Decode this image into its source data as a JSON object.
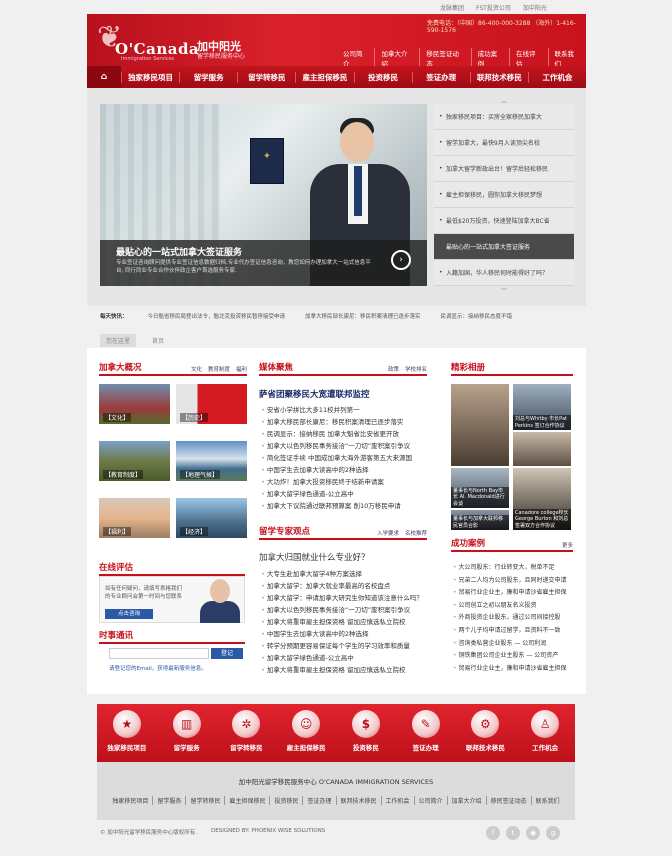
{
  "toplinks": [
    "龙脉集团",
    "FST投资公司",
    "加中阳光"
  ],
  "header": {
    "logo_name": "O'Canada",
    "logo_sub": "Immigration Services",
    "brand_cn": "加中阳光",
    "brand_cn_sub": "留学移民服务中心",
    "phone": "免费电话：（中国）86-400-000-3288 （海外）1-416-590-1576",
    "menu": [
      "公司简介",
      "加拿大介绍",
      "移民签证动态",
      "成功案例",
      "在线评估",
      "联系我们"
    ]
  },
  "nav": {
    "home_icon": "home-icon",
    "items": [
      "独家移民项目",
      "留学服务",
      "留学转移民",
      "雇主担保移民",
      "投资移民",
      "签证办理",
      "联邦技术移民",
      "工作机会"
    ]
  },
  "banner": {
    "headline": "最贴心的一站式加拿大签证服务",
    "desc": "专业签证咨询顾问提供专业签证信息数据归档,专业代办签证信息咨询，教您如何办理加拿大一站式信息平台, 同行同业专业合作伙伴政企客户首选服务专家.",
    "list": [
      "独家移民项目：买房全家移民加拿大",
      "留学加拿大，最快9月入读顶尖名校",
      "加拿大留学新政出台！留学后轻松移民",
      "雇主担保移民，圆你加拿大移民梦想",
      "最低$20万投资，快速登陆加拿大BC省",
      "最贴心的一站式加拿大签证服务",
      "入籍加国，华人移民何时能得好了吗？"
    ],
    "active_index": 5
  },
  "ticker": {
    "label": "每天快讯：",
    "items": [
      "今日魁省移民局登出法令，魁北克投资移民暂停接受申请",
      "加拿大移民部长康尼：移民积案清理已逐步落实",
      "民调显示：接纳移民态度不错"
    ]
  },
  "crumb": [
    "您在这里",
    "首页"
  ],
  "canada": {
    "title": "加拿大概况",
    "links": [
      "文化",
      "教育制度",
      "福利"
    ],
    "thumbs": [
      "【文化】",
      "【历史】",
      "【教育制度】",
      "【地理气候】",
      "【福利】",
      "【经济】"
    ]
  },
  "media": {
    "title": "媒体聚焦",
    "links": [
      "政策",
      "学校排名"
    ],
    "headline": "萨省团聚移民大宽遭联邦监控",
    "items": [
      "安省小学拼比大多11校并列第一",
      "加拿大移民部长康尼：移民积案清理已逐步落实",
      "民调显示：接纳移民 加拿大魁省比安省更开放",
      "加拿大以色列移民事务接洽“一刀切”废积案引争议",
      "简化签证手续 中国成加拿大海外游客第五大来源国",
      "中国学生去加拿大读高中的2种选择",
      "大功炸！加拿大投资移民终于结新申请案",
      "加拿大留学绿色通道-公立高中",
      "加拿大下议院通过联邦预算案 削10万移民申请"
    ]
  },
  "expert": {
    "title": "留学专家观点",
    "links": [
      "入学要求",
      "名校推荐"
    ],
    "headline": "加拿大归国就业什么专业好？",
    "items": [
      "大专生赴加拿大留学4种方案选择",
      "加拿大留学：加拿大就业率最高的名校盘点",
      "加拿大留学：申请加拿大研究生你知道该注意什么吗？",
      "加拿大以色列移民事务接洽“一刀切”废积案引争议",
      "加拿大将重审雇主担保资格 留加应慎选私立院校",
      "中国学生去加拿大读高中的2种选择",
      "转学分预期更容易保证每个学生的学习效率和质量",
      "加拿大留学绿色通道-公立高中",
      "加拿大将重审雇主担保资格 留加应慎选私立院校"
    ]
  },
  "photos": {
    "title": "精彩相册",
    "captions": [
      "刘总与Whitby 市长Pat Perkins 签订合作协议",
      "董事长与North Bay市长 Al. Macdonald进行会谈",
      "Canadore college校长 George Burton 和刘总签署双方合作协议",
      "董事长与加拿大联邦移民官员合影"
    ]
  },
  "evaluate": {
    "title": "在线评估",
    "text": "如有任何疑问，请填写表格我们的专业顾问会第一时间与您联系",
    "button": "点击咨询"
  },
  "subscribe": {
    "title": "时事通讯",
    "placeholder": "",
    "button": "登记",
    "note": "请登记您的Email，获得最新服务信息。"
  },
  "cases": {
    "title": "成功案例",
    "more": "更多",
    "items": [
      "大公司股东：行业转变大，税单不足",
      "兄弟二人均为公司股东，且同时递交申请",
      "贸易行业企业主，廉和申请沙省雇主担保",
      "公司创立之初以朋友名义投资",
      "外商投资企业股东，通过公司间接控股",
      "两个儿子均申请过留学，且资料不一致",
      "咨询类私营企业股东 — 公司利润",
      "铜铁集团公司企业主股东 — 公司资产",
      "贸易行业企业主，廉和申请沙省雇主担保"
    ]
  },
  "services": [
    {
      "label": "独家移民项目",
      "icon": "badge-icon"
    },
    {
      "label": "留学服务",
      "icon": "chart-icon"
    },
    {
      "label": "留学转移民",
      "icon": "network-icon"
    },
    {
      "label": "雇主担保移民",
      "icon": "people-icon"
    },
    {
      "label": "投资移民",
      "icon": "coins-icon"
    },
    {
      "label": "签证办理",
      "icon": "stamp-icon"
    },
    {
      "label": "联邦技术移民",
      "icon": "gear-icon"
    },
    {
      "label": "工作机会",
      "icon": "person-icon"
    }
  ],
  "footer": {
    "title": "加中阳光留学移民服务中心    O'CANADA IMMIGRATION SERVICES",
    "links": [
      "独家移民项目",
      "留学服务",
      "留学转移民",
      "雇主担保移民",
      "投资移民",
      "签证办理",
      "联邦技术移民",
      "工作机会",
      "公司简介",
      "加拿大介绍",
      "移民签证动态",
      "联系我们"
    ],
    "copyright": "© 加中阳光留学移民服务中心版权所有.",
    "designed": "DESIGNED BY: PHOENIX WISE SOLUTIONS",
    "social": [
      "facebook-icon",
      "twitter-icon",
      "rss-icon",
      "google-plus-icon"
    ]
  },
  "colors": {
    "brand_red": "#c8101b",
    "link_blue": "#2a59a8"
  }
}
